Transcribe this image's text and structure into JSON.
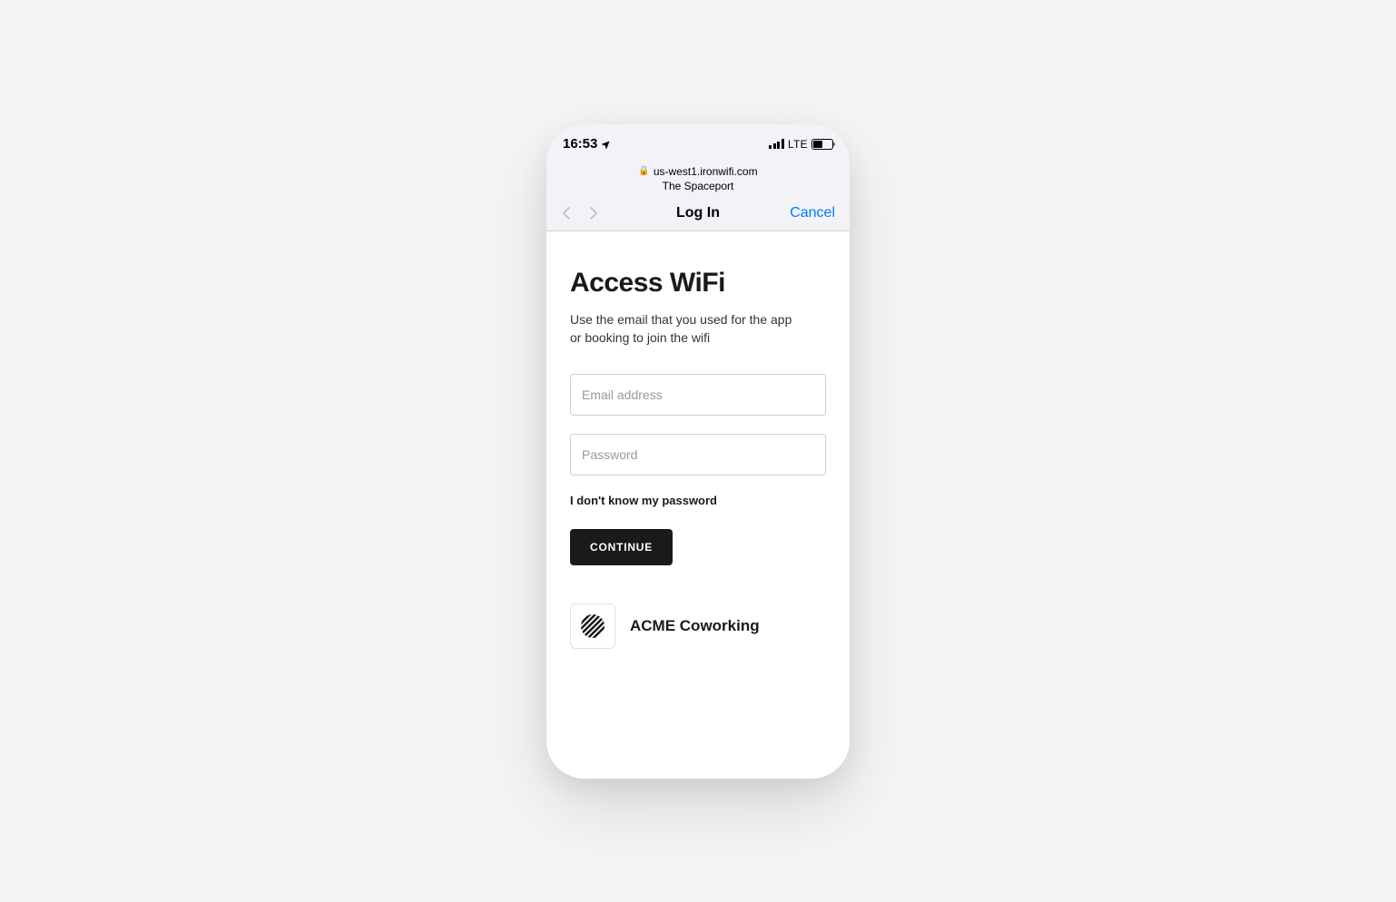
{
  "status_bar": {
    "time": "16:53",
    "network_type": "LTE"
  },
  "url_bar": {
    "domain": "us-west1.ironwifi.com",
    "site_name": "The Spaceport"
  },
  "nav_bar": {
    "title": "Log In",
    "cancel_label": "Cancel"
  },
  "page": {
    "title": "Access WiFi",
    "description": "Use the email that you used for the app or booking to join the wifi"
  },
  "form": {
    "email_placeholder": "Email address",
    "password_placeholder": "Password",
    "forgot_password_text": "I don't know my password",
    "continue_button": "CONTINUE"
  },
  "brand": {
    "name": "ACME Coworking"
  }
}
